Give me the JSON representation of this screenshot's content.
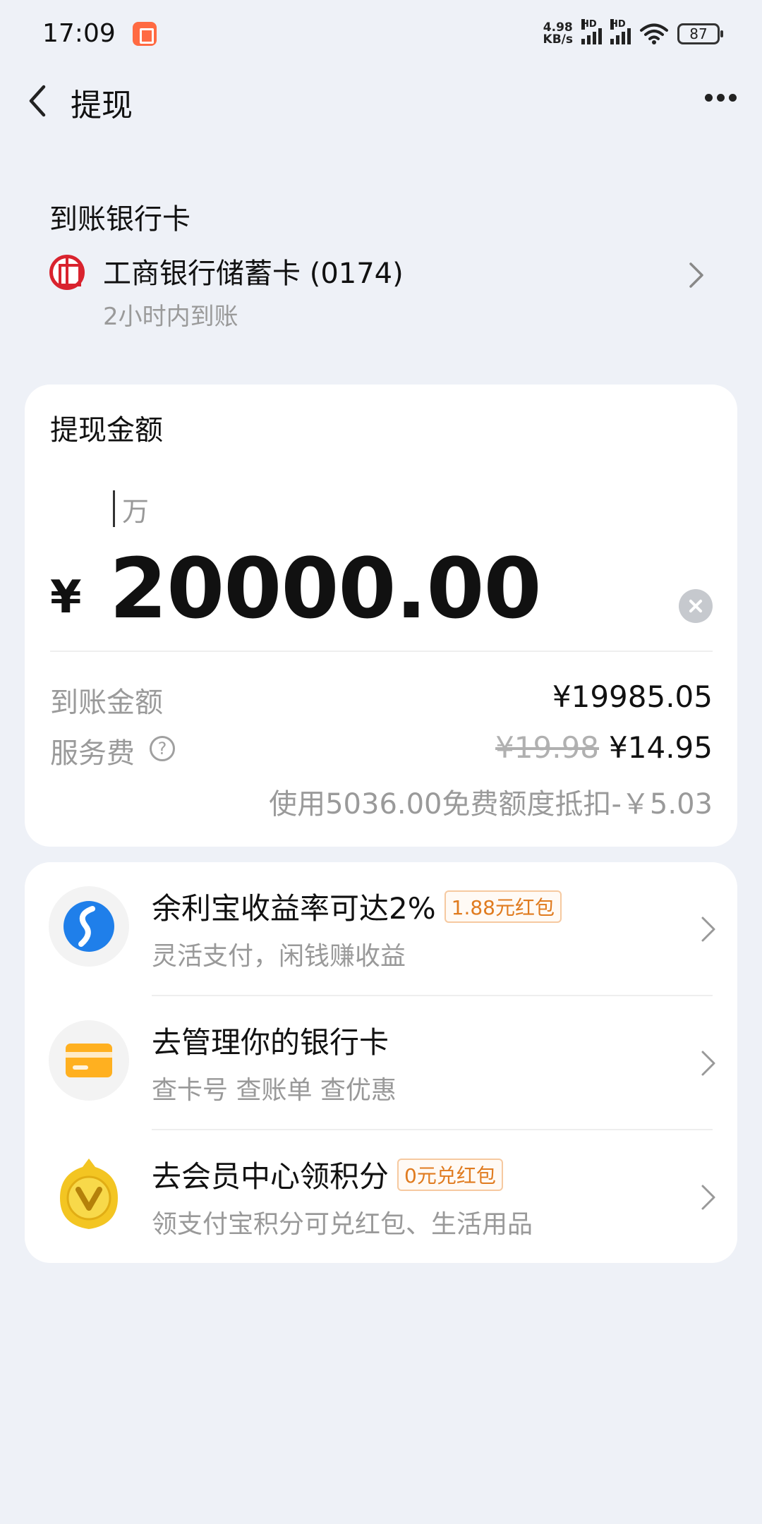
{
  "status_bar": {
    "time": "17:09",
    "net_speed_value": "4.98",
    "net_speed_unit": "KB/s",
    "signal_label": "HD",
    "battery": "87"
  },
  "nav": {
    "title": "提现"
  },
  "bank": {
    "section_label": "到账银行卡",
    "name": "工商银行储蓄卡 (0174)",
    "eta": "2小时内到账"
  },
  "amount": {
    "label": "提现金额",
    "unit_hint": "万",
    "currency_symbol": "¥",
    "value": "20000.00",
    "received_label": "到账金额",
    "received_value": "¥19985.05",
    "fee_label": "服务费",
    "fee_help": "?",
    "fee_original": "¥19.98",
    "fee_current": "¥14.95",
    "discount_note": "使用5036.00免费额度抵扣-￥5.03"
  },
  "promos": [
    {
      "title": "余利宝收益率可达2%",
      "badge": "1.88元红包",
      "subtitle": "灵活支付，闲钱赚收益",
      "icon": "yulibao-icon"
    },
    {
      "title": "去管理你的银行卡",
      "badge": "",
      "subtitle": "查卡号 查账单 查优惠",
      "icon": "bank-card-icon"
    },
    {
      "title": "去会员中心领积分",
      "badge": "0元兑红包",
      "subtitle": "领支付宝积分可兑红包、生活用品",
      "icon": "member-v-icon"
    }
  ],
  "colors": {
    "background": "#eef1f7",
    "accent_orange": "#e07b1f",
    "bank_red": "#d9232e",
    "yulibao_blue": "#1f7fea",
    "card_orange": "#ffb020",
    "member_gold": "#f3c522"
  }
}
